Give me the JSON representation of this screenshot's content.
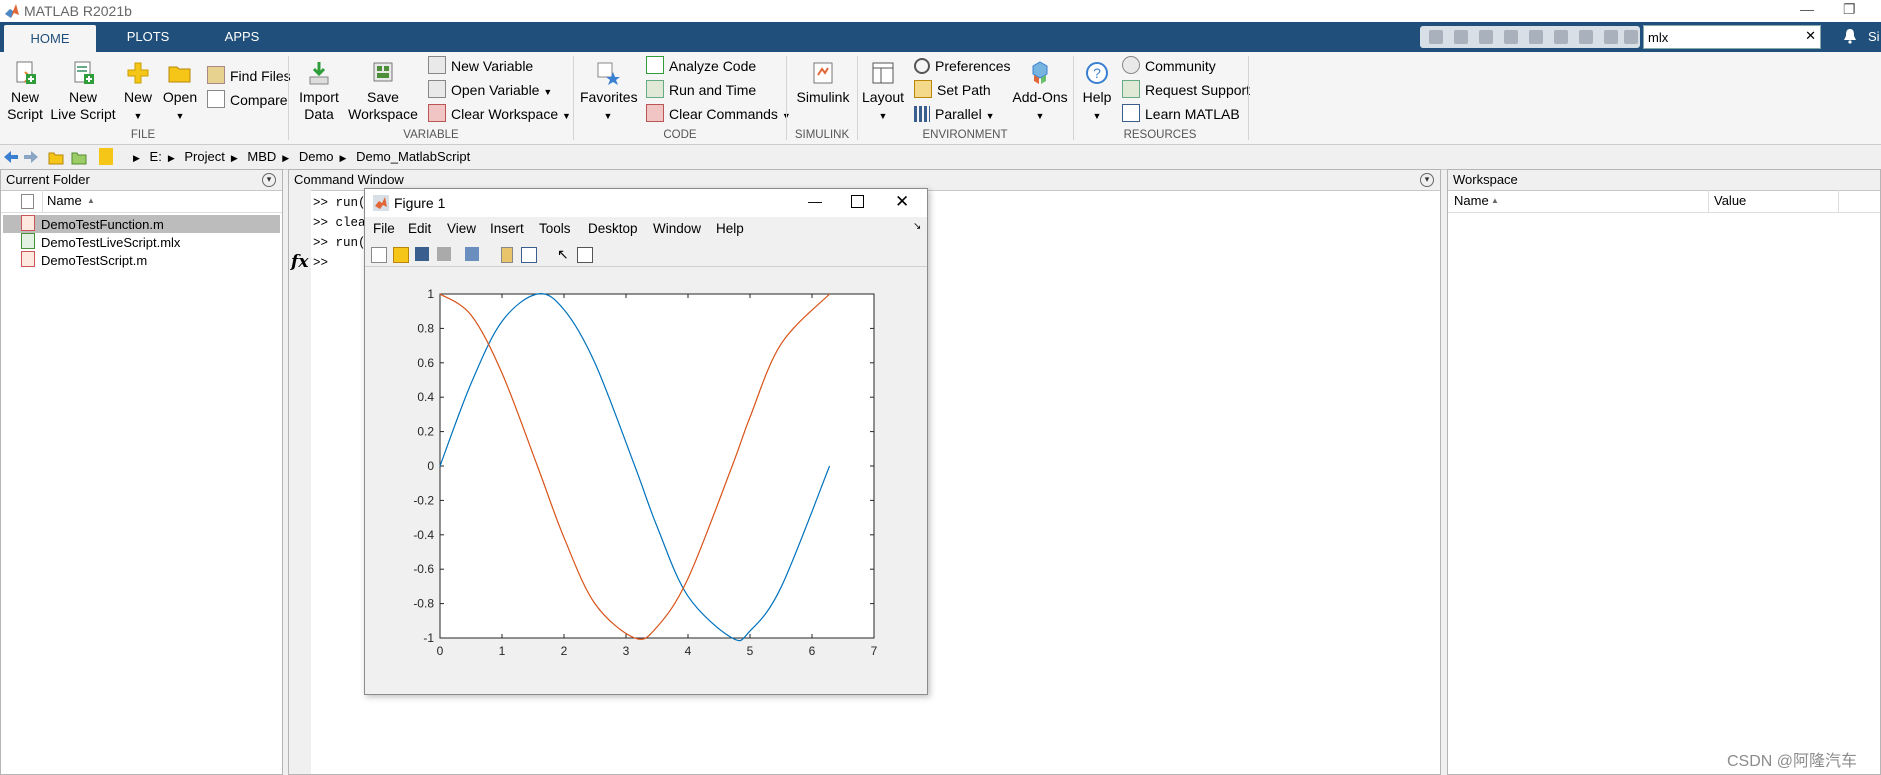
{
  "app": {
    "title": "MATLAB R2021b"
  },
  "tabs": [
    {
      "label": "HOME"
    },
    {
      "label": "PLOTS"
    },
    {
      "label": "APPS"
    }
  ],
  "search": {
    "value": "mlx",
    "partial_label": "Si"
  },
  "ribbon": {
    "file": {
      "group_label": "FILE",
      "new_script": [
        "New",
        "Script"
      ],
      "new_live_script": [
        "New",
        "Live Script"
      ],
      "new": "New",
      "open": "Open",
      "find_files": "Find Files",
      "compare": "Compare"
    },
    "variable": {
      "group_label": "VARIABLE",
      "import_data": [
        "Import",
        "Data"
      ],
      "save_workspace": [
        "Save",
        "Workspace"
      ],
      "new_variable": "New Variable",
      "open_variable": "Open Variable",
      "clear_workspace": "Clear Workspace"
    },
    "code": {
      "group_label": "CODE",
      "favorites": "Favorites",
      "analyze_code": "Analyze Code",
      "run_and_time": "Run and Time",
      "clear_commands": "Clear Commands"
    },
    "simulink": {
      "group_label": "SIMULINK",
      "simulink": "Simulink"
    },
    "environment": {
      "group_label": "ENVIRONMENT",
      "layout": "Layout",
      "preferences": "Preferences",
      "set_path": "Set Path",
      "parallel": "Parallel",
      "add_ons": "Add-Ons"
    },
    "resources": {
      "group_label": "RESOURCES",
      "help": "Help",
      "community": "Community",
      "request_support": "Request Support",
      "learn_matlab": "Learn MATLAB"
    }
  },
  "address": {
    "path": [
      "E:",
      "Project",
      "MBD",
      "Demo",
      "Demo_MatlabScript"
    ]
  },
  "current_folder": {
    "title": "Current Folder",
    "column_name": "Name",
    "files": [
      {
        "name": "DemoTestFunction.m"
      },
      {
        "name": "DemoTestLiveScript.mlx"
      },
      {
        "name": "DemoTestScript.m"
      }
    ]
  },
  "command_window": {
    "title": "Command Window",
    "lines": [
      ">> run(",
      ">> clea",
      ">> run("
    ],
    "prompt": ">>",
    "fx": "fx"
  },
  "workspace": {
    "title": "Workspace",
    "col_name": "Name",
    "col_value": "Value"
  },
  "figure": {
    "title": "Figure 1",
    "menu": [
      "File",
      "Edit",
      "View",
      "Insert",
      "Tools",
      "Desktop",
      "Window",
      "Help"
    ]
  },
  "chart_data": {
    "type": "line",
    "title": "",
    "xlabel": "",
    "ylabel": "",
    "xlim": [
      0,
      7
    ],
    "ylim": [
      -1,
      1
    ],
    "xticks": [
      0,
      1,
      2,
      3,
      4,
      5,
      6,
      7
    ],
    "yticks": [
      1,
      0.8,
      0.6,
      0.4,
      0.2,
      0,
      -0.2,
      -0.4,
      -0.6,
      -0.8,
      -1
    ],
    "ytick_labels": [
      "1",
      "0.8",
      "0.6",
      "0.4",
      "0.2",
      "0",
      "-0.2",
      "-0.4",
      "-0.6",
      "-0.8",
      "-1"
    ],
    "grid": false,
    "series": [
      {
        "color": "#0072bd",
        "x": [
          0,
          0.5,
          1.0,
          1.5708,
          2.0,
          2.5,
          3.1416,
          3.5,
          4.0,
          4.7124,
          5.0,
          5.5,
          6.2832
        ],
        "y": [
          0,
          0.479,
          0.841,
          1,
          0.909,
          0.598,
          0,
          -0.351,
          -0.757,
          -1,
          -0.959,
          -0.706,
          0
        ]
      },
      {
        "color": "#d95319",
        "x": [
          0,
          0.5,
          1.0,
          1.5708,
          2.0,
          2.5,
          3.1416,
          3.5,
          4.0,
          4.7124,
          5.0,
          5.5,
          6.2832
        ],
        "y": [
          1,
          0.878,
          0.54,
          0,
          -0.416,
          -0.801,
          -1,
          -0.936,
          -0.654,
          0,
          0.284,
          0.709,
          1
        ]
      }
    ]
  },
  "watermark": "CSDN @阿隆汽车",
  "colors": {
    "tabbar": "#1f4f7a",
    "series1": "#0072bd",
    "series2": "#d95319"
  }
}
